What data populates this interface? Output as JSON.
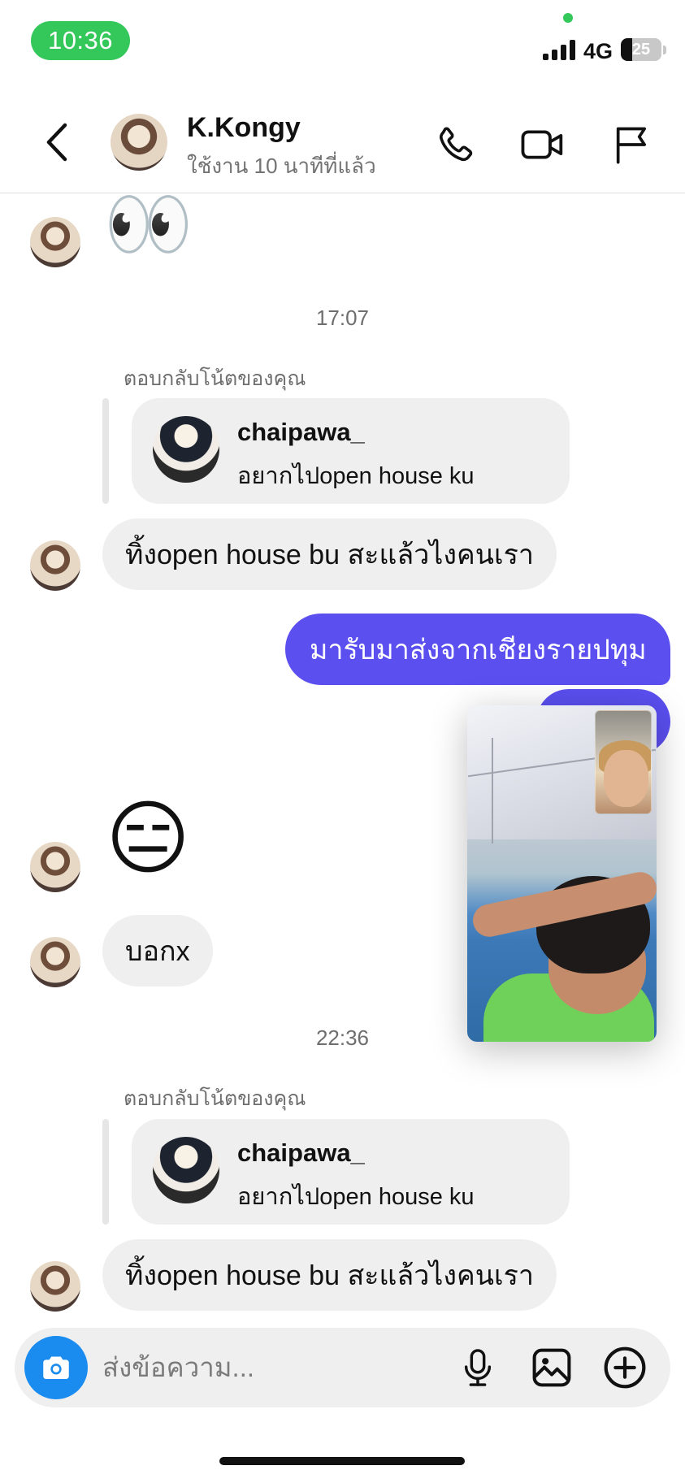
{
  "status_bar": {
    "time": "10:36",
    "network": "4G",
    "battery": "25",
    "colors": {
      "time_pill": "#34c759"
    }
  },
  "header": {
    "contact_name": "K.Kongy",
    "contact_status": "ใช้งาน 10 นาทีที่แล้ว",
    "icons": [
      "back-icon",
      "phone-icon",
      "video-camera-icon",
      "flag-icon"
    ]
  },
  "messages": {
    "emoji_eyes": "👀",
    "timestamp_1": "17:07",
    "reply_note_1": "ตอบกลับโน้ตของคุณ",
    "reply_card_1": {
      "user": "chaipawa_",
      "text": "อยากไปopen house ku"
    },
    "incoming_1": "ทิ้งopen house bu สะแล้วไงคนเรา",
    "outgoing_1": "มารับมาส่งจากเชียงรายปทุม",
    "emoji_neutral": "😑",
    "incoming_2": "บอกx",
    "timestamp_2": "22:36",
    "reply_note_2": "ตอบกลับโน้ตของคุณ",
    "reply_card_2": {
      "user": "chaipawa_",
      "text": "อยากไปopen house ku"
    },
    "incoming_3": "ทิ้งopen house bu สะแล้วไงคนเรา"
  },
  "composer": {
    "placeholder": "ส่งข้อความ...",
    "icons": [
      "camera-icon",
      "microphone-icon",
      "image-icon",
      "add-circle-icon"
    ]
  },
  "colors": {
    "outgoing_bubble": "#5b4ff0",
    "incoming_bubble": "#efefef",
    "camera_button": "#1a8cf0"
  }
}
